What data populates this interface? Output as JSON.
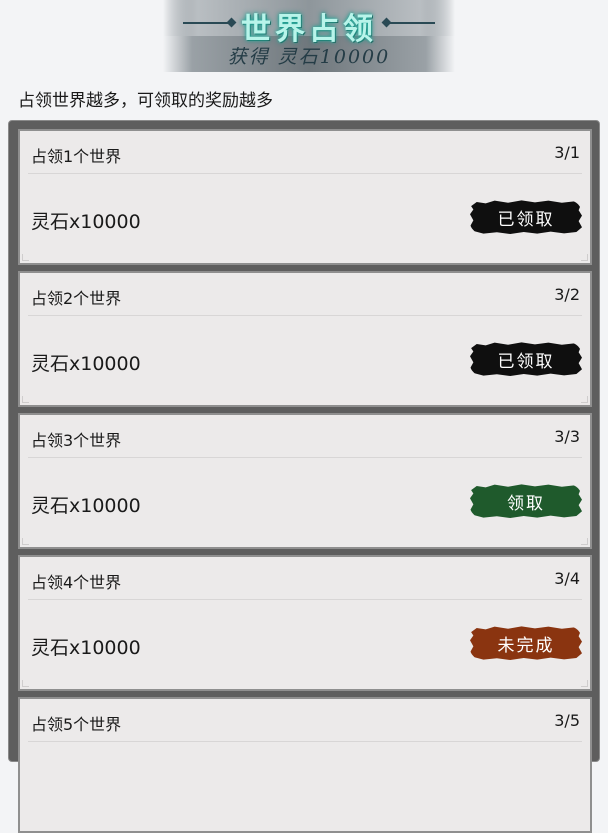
{
  "banner": {
    "title": "世界占领",
    "subtitle": "获得 灵石10000"
  },
  "subtitle": "占领世界越多，可领取的奖励越多",
  "tasks": [
    {
      "title": "占领1个世界",
      "progress": "3/1",
      "reward": "灵石x10000",
      "button": "已领取",
      "status": "claimed"
    },
    {
      "title": "占领2个世界",
      "progress": "3/2",
      "reward": "灵石x10000",
      "button": "已领取",
      "status": "claimed"
    },
    {
      "title": "占领3个世界",
      "progress": "3/3",
      "reward": "灵石x10000",
      "button": "领取",
      "status": "claimable"
    },
    {
      "title": "占领4个世界",
      "progress": "3/4",
      "reward": "灵石x10000",
      "button": "未完成",
      "status": "incomplete"
    },
    {
      "title": "占领5个世界",
      "progress": "3/5",
      "reward": "",
      "button": "",
      "status": "incomplete"
    }
  ],
  "colors": {
    "claimed": "#0f0f0f",
    "claimable": "#1f5a2c",
    "incomplete": "#8a3410",
    "title_glow": "#b8f4ea"
  }
}
